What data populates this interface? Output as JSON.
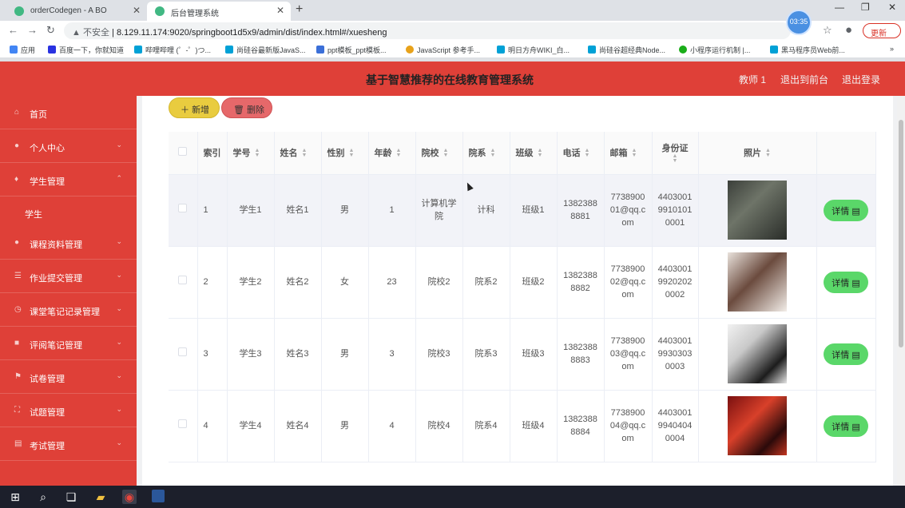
{
  "browser": {
    "tabs": [
      {
        "label": "orderCodegen - A BO",
        "active": false
      },
      {
        "label": "后台管理系统",
        "active": true
      }
    ],
    "insecure_label": "不安全",
    "url": "8.129.11.174:9020/springboot1d5x9/admin/dist/index.html#/xuesheng",
    "clock": "03:35",
    "update_label": "更新",
    "bookmarks": [
      "应用",
      "百度一下，你就知道",
      "哔哩哔哩 (゜-゜)つ...",
      "尚硅谷最新版JavaS...",
      "ppt模板_ppt模板...",
      "JavaScript 参考手...",
      "明日方舟WIKI_白...",
      "尚硅谷超经典Node...",
      "小程序运行机制 |...",
      "黑马程序员Web前..."
    ]
  },
  "header": {
    "title": "基于智慧推荐的在线教育管理系统",
    "user": "教师 1",
    "back_to_front": "退出到前台",
    "logout": "退出登录"
  },
  "sidebar": {
    "items": [
      {
        "label": "首页",
        "icon": "home-icon"
      },
      {
        "label": "个人中心",
        "icon": "user-icon"
      },
      {
        "label": "学生管理",
        "icon": "microphone-icon"
      },
      {
        "label": "学生",
        "icon": ""
      },
      {
        "label": "课程资料管理",
        "icon": "person-icon"
      },
      {
        "label": "作业提交管理",
        "icon": "list-icon"
      },
      {
        "label": "课堂笔记记录管理",
        "icon": "clock-icon"
      },
      {
        "label": "评阅笔记管理",
        "icon": "chat-icon"
      },
      {
        "label": "试卷管理",
        "icon": "flag-icon"
      },
      {
        "label": "试题管理",
        "icon": "frame-icon"
      },
      {
        "label": "考试管理",
        "icon": "bank-icon"
      }
    ]
  },
  "toolbar": {
    "add_label": "新增",
    "delete_label": "删除"
  },
  "table": {
    "headers": [
      "索引",
      "学号",
      "姓名",
      "性别",
      "年龄",
      "院校",
      "院系",
      "班级",
      "电话",
      "邮箱",
      "身份证",
      "照片"
    ],
    "detail_label": "详情",
    "rows": [
      {
        "index": "1",
        "student_no": "学生1",
        "name": "姓名1",
        "gender": "男",
        "age": "1",
        "school": "计算机学院",
        "dept": "计科",
        "class": "班级1",
        "phone": "13823888881",
        "email": "773890001@qq.com",
        "id_card": "440300199101010001"
      },
      {
        "index": "2",
        "student_no": "学生2",
        "name": "姓名2",
        "gender": "女",
        "age": "23",
        "school": "院校2",
        "dept": "院系2",
        "class": "班级2",
        "phone": "13823888882",
        "email": "773890002@qq.com",
        "id_card": "440300199202020002"
      },
      {
        "index": "3",
        "student_no": "学生3",
        "name": "姓名3",
        "gender": "男",
        "age": "3",
        "school": "院校3",
        "dept": "院系3",
        "class": "班级3",
        "phone": "13823888883",
        "email": "773890003@qq.com",
        "id_card": "440300199303030003"
      },
      {
        "index": "4",
        "student_no": "学生4",
        "name": "姓名4",
        "gender": "男",
        "age": "4",
        "school": "院校4",
        "dept": "院系4",
        "class": "班级4",
        "phone": "13823888884",
        "email": "773890004@qq.com",
        "id_card": "440300199404040004"
      }
    ]
  },
  "colors": {
    "brand_red": "#df4038",
    "add_yellow": "#e9cc3f",
    "delete_red": "#e6686a",
    "detail_green": "#5ad769"
  }
}
